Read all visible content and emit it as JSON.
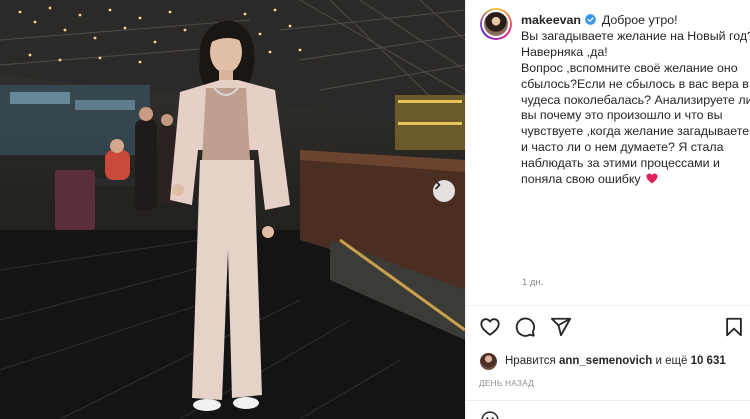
{
  "post": {
    "username": "makeevan",
    "caption_lines": [
      "Доброе утро!",
      "Вы загадываете желание на Новый год?Наверняка ,да!",
      "Вопрос ,вспомните своё желание оно сбылось?Если не сбылось в вас вера в чудеса поколебалась? Анализируете ли вы почему это произошло и что вы чувствуете ,когда желание загадываете и часто ли о нем думаете? Я стала наблюдать за этими процессами и поняла свою ошибку"
    ],
    "caption_time": "1 дн.",
    "liked_by_prefix": "Нравится",
    "liked_by_user": "ann_semenovich",
    "liked_by_and": "и ещё",
    "likes_count": "10 631",
    "posted_ago": "ДЕНЬ НАЗАД"
  },
  "icons": {
    "verified": "verified-badge-icon",
    "heart": "heart-icon",
    "comment": "comment-icon",
    "share": "share-icon",
    "bookmark": "bookmark-icon",
    "next": "chevron-right-icon",
    "emoji": "emoji-icon",
    "red_heart": "red-heart-emoji"
  },
  "colors": {
    "verified_blue": "#3897f0",
    "text": "#262626",
    "secondary_text": "#8e8e8e",
    "red_heart": "#e0245e"
  }
}
